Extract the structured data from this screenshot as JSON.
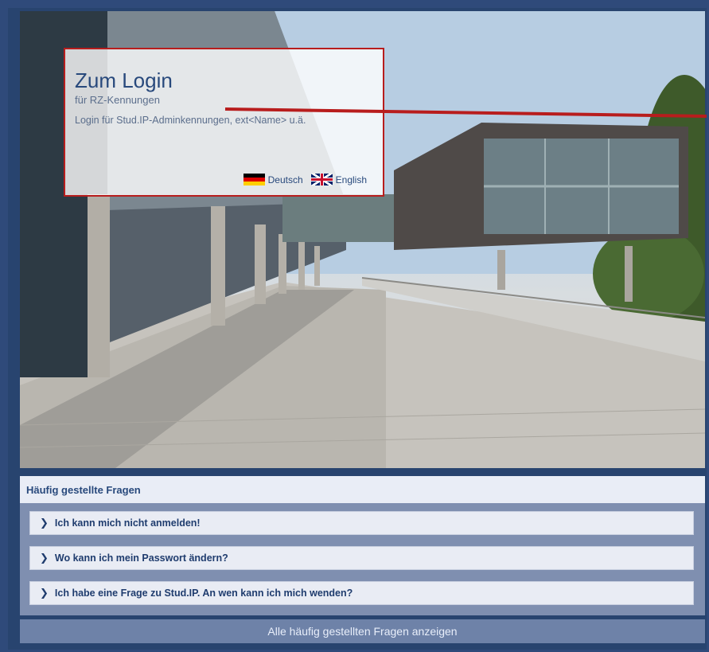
{
  "login": {
    "title": "Zum Login",
    "subtitle": "für RZ-Kennungen",
    "description": "Login für Stud.IP-Adminkennungen, ext<Name> u.ä.",
    "languages": [
      {
        "label": "Deutsch",
        "flag": "de-flag-icon"
      },
      {
        "label": "English",
        "flag": "uk-flag-icon"
      }
    ]
  },
  "faq": {
    "header": "Häufig gestellte Fragen",
    "items": [
      {
        "label": "Ich kann mich nicht anmelden!"
      },
      {
        "label": "Wo kann ich mein Passwort ändern?"
      },
      {
        "label": "Ich habe eine Frage zu Stud.IP. An wen kann ich mich wenden?"
      }
    ],
    "show_all": "Alle häufig gestellten Fragen anzeigen"
  },
  "colors": {
    "accent": "#28497c",
    "highlight_border": "#b81d1d"
  }
}
